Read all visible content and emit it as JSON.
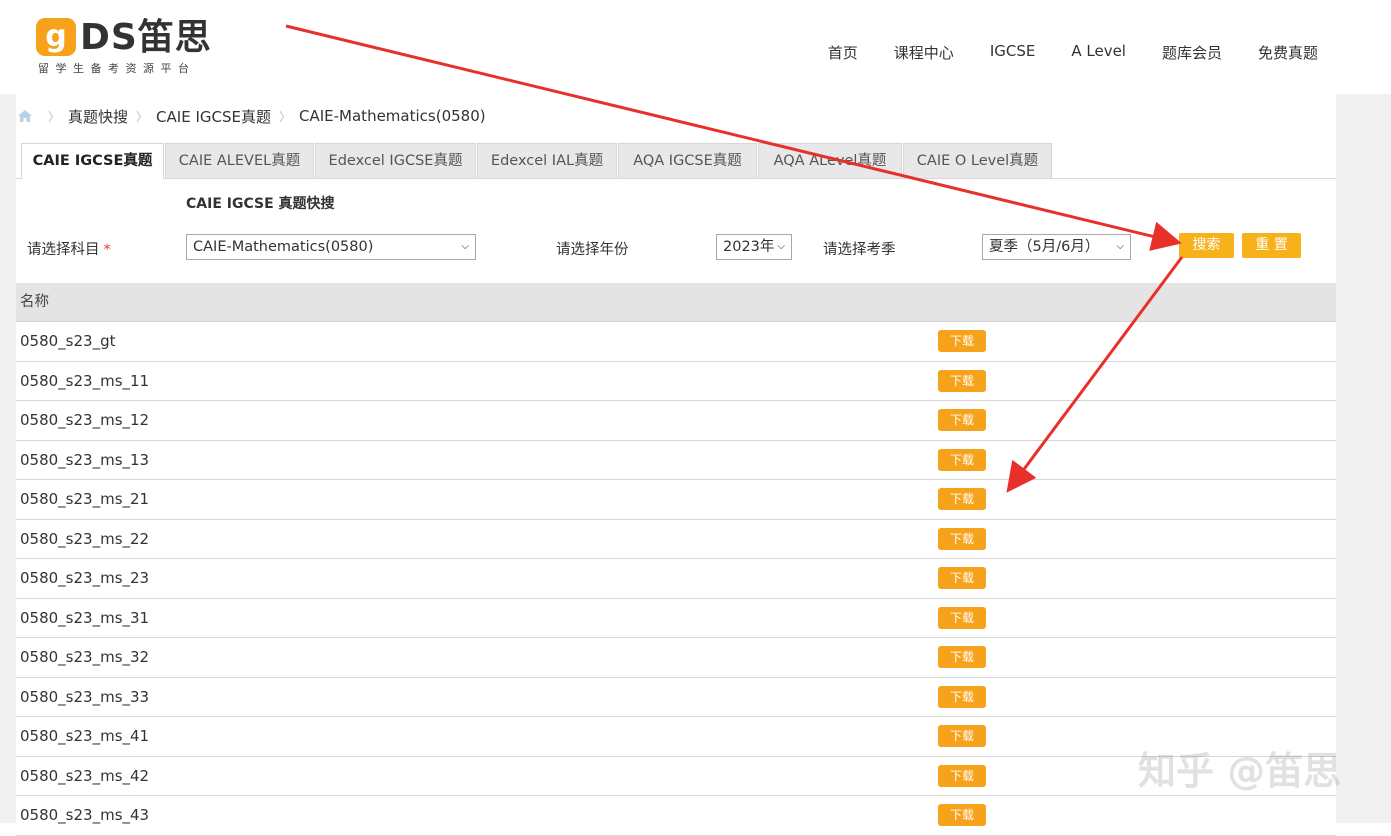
{
  "header": {
    "logo_mark": "g",
    "logo_text": "DS笛思",
    "logo_sub": "留学生备考资源平台",
    "nav": [
      "首页",
      "课程中心",
      "IGCSE",
      "A Level",
      "题库会员",
      "免费真题"
    ]
  },
  "breadcrumb": [
    "真题快搜",
    "CAIE IGCSE真题",
    "CAIE-Mathematics(0580)"
  ],
  "tabs": [
    "CAIE IGCSE真题",
    "CAIE ALEVEL真题",
    "Edexcel IGCSE真题",
    "Edexcel IAL真题",
    "AQA IGCSE真题",
    "AQA ALevel真题",
    "CAIE O Level真题"
  ],
  "form": {
    "title": "CAIE IGCSE 真题快搜",
    "subject_label": "请选择科目",
    "required_mark": "*",
    "subject_value": "CAIE-Mathematics(0580)",
    "year_label": "请选择年份",
    "year_value": "2023年",
    "season_label": "请选择考季",
    "season_value": "夏季（5月/6月）",
    "search_label": "搜索",
    "reset_label": "重 置"
  },
  "table": {
    "header": "名称",
    "download_label": "下载",
    "rows": [
      "0580_s23_gt",
      "0580_s23_ms_11",
      "0580_s23_ms_12",
      "0580_s23_ms_13",
      "0580_s23_ms_21",
      "0580_s23_ms_22",
      "0580_s23_ms_23",
      "0580_s23_ms_31",
      "0580_s23_ms_32",
      "0580_s23_ms_33",
      "0580_s23_ms_41",
      "0580_s23_ms_42",
      "0580_s23_ms_43"
    ]
  },
  "watermark": "知乎 @笛思",
  "colors": {
    "accent": "#f7a21b",
    "arrow": "#e8302a"
  }
}
